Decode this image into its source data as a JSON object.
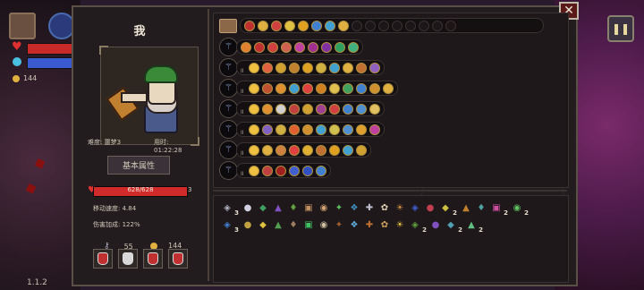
{
  "hud": {
    "coins": "144",
    "version": "1.1.2",
    "pause_icon": "pause-icon"
  },
  "character": {
    "name": "我",
    "difficulty_label": "难度: 噩梦3",
    "time_label": "用时: 01:22:28",
    "section_button": "基本属性",
    "hp_current": 628,
    "hp_max": 628,
    "hp_text": "628/628",
    "hp_extra": "3",
    "move_speed": "移动速度: 4.84",
    "damage_bonus": "伤害加成: 122%",
    "keys": "55",
    "gold": "144",
    "potions": [
      {
        "name": "red-potion",
        "color": "#c03030"
      },
      {
        "name": "white-potion",
        "color": "#d8d8d8"
      },
      {
        "name": "red-potion",
        "color": "#c03030"
      },
      {
        "name": "red-potion",
        "color": "#c03030"
      }
    ]
  },
  "weapon_rows": [
    {
      "weapon_icon": "staff-green-icon",
      "level": "",
      "runes": [
        "#e08030",
        "#c03030",
        "#d04040",
        "#d06050",
        "#c040a0",
        "#a03090",
        "#8030a0",
        "#30a060",
        "#40b080"
      ]
    },
    {
      "weapon_icon": "staff-blue-icon",
      "level": "II",
      "runes": [
        "#f0c040",
        "#e06040",
        "#d0a030",
        "#c08030",
        "#e0a020",
        "#d0b040",
        "#40a0d0",
        "#e0b040",
        "#c07030",
        "#9060c0"
      ]
    },
    {
      "weapon_icon": "staff-silver-icon",
      "level": "II",
      "runes": [
        "#f0c040",
        "#c05030",
        "#e09030",
        "#40a0d0",
        "#e04040",
        "#d08020",
        "#e0c050",
        "#40a060",
        "#4080d0",
        "#d09030",
        "#e0b040"
      ]
    },
    {
      "weapon_icon": "staff-purple-icon",
      "level": "II",
      "runes": [
        "#f0c040",
        "#e09030",
        "#d0d0d0",
        "#c04040",
        "#d0a030",
        "#a04090",
        "#d04040",
        "#4080d0",
        "#5090d0",
        "#e0c060"
      ]
    },
    {
      "weapon_icon": "staff-violet-icon",
      "level": "II",
      "runes": [
        "#f0c040",
        "#8060c0",
        "#d0b040",
        "#e06030",
        "#d09030",
        "#40a0d0",
        "#d0c050",
        "#5090d0",
        "#e0a030",
        "#c040a0"
      ]
    },
    {
      "weapon_icon": "staff-gold-icon",
      "level": "II",
      "runes": [
        "#f0c040",
        "#e0b040",
        "#d08040",
        "#e04040",
        "#e0b030",
        "#c07030",
        "#e0a020",
        "#40a0d0",
        "#d0a030"
      ]
    },
    {
      "weapon_icon": "staff-red-icon",
      "level": "II",
      "runes": [
        "#f0c040",
        "#c04040",
        "#a02020",
        "#4060d0",
        "#3050c0",
        "#4080d0"
      ]
    }
  ],
  "header_runes": [
    "#c03030",
    "#e0b040",
    "#d04040",
    "#e0c040",
    "#e0a020",
    "#4080d0",
    "#40a0d0",
    "#e0b040"
  ],
  "items": {
    "row1": [
      {
        "icon": "shield-ring-icon",
        "count": "3",
        "color": "#b0b0c0"
      },
      {
        "icon": "pearl-icon",
        "color": "#d0d0e0"
      },
      {
        "icon": "green-gem-icon",
        "color": "#40a060"
      },
      {
        "icon": "purple-hat-icon",
        "color": "#8050c0"
      },
      {
        "icon": "green-bottle-icon",
        "color": "#60a040"
      },
      {
        "icon": "scroll-icon",
        "color": "#c09060"
      },
      {
        "icon": "cake-icon",
        "color": "#d0a070"
      },
      {
        "icon": "green-seed-icon",
        "color": "#60c060"
      },
      {
        "icon": "orb-icon",
        "color": "#4090c0"
      },
      {
        "icon": "magnifier-icon",
        "color": "#c0c0d0"
      },
      {
        "icon": "bone-icon",
        "color": "#e0d0b0"
      },
      {
        "icon": "lantern-icon",
        "color": "#d09040"
      },
      {
        "icon": "blue-flower-icon",
        "color": "#4060d0"
      },
      {
        "icon": "knot-icon",
        "color": "#c04050"
      },
      {
        "icon": "yellow-horn-icon",
        "count": "2",
        "color": "#d0c040"
      },
      {
        "icon": "boot-icon",
        "color": "#c08030"
      },
      {
        "icon": "gear-icon",
        "color": "#50a0a0"
      },
      {
        "icon": "candy-icon",
        "count": "2",
        "color": "#d050a0"
      },
      {
        "icon": "feather-icon",
        "count": "2",
        "color": "#60c060"
      }
    ],
    "row2": [
      {
        "icon": "blue-flame-icon",
        "count": "3",
        "color": "#4080d0"
      },
      {
        "icon": "wing-icon",
        "color": "#c0a040"
      },
      {
        "icon": "sun-icon",
        "color": "#e0c040"
      },
      {
        "icon": "leaf-icon",
        "color": "#50a050"
      },
      {
        "icon": "sack-icon",
        "color": "#a08060"
      },
      {
        "icon": "clover-icon",
        "color": "#40c060"
      },
      {
        "icon": "skull-icon",
        "color": "#d0c0a0"
      },
      {
        "icon": "book-icon",
        "color": "#a06030"
      },
      {
        "icon": "snowflake-icon",
        "color": "#60b0e0"
      },
      {
        "icon": "rune-stone-icon",
        "color": "#c07030"
      },
      {
        "icon": "cookie-icon",
        "color": "#d0a060"
      },
      {
        "icon": "lightning-icon",
        "color": "#e0c040"
      },
      {
        "icon": "boot-green-icon",
        "count": "2",
        "color": "#60a040"
      },
      {
        "icon": "mask-icon",
        "color": "#8050c0"
      },
      {
        "icon": "fish-icon",
        "count": "2",
        "color": "#50a0b0"
      },
      {
        "icon": "crystal-icon",
        "count": "2",
        "color": "#60c080"
      }
    ]
  }
}
